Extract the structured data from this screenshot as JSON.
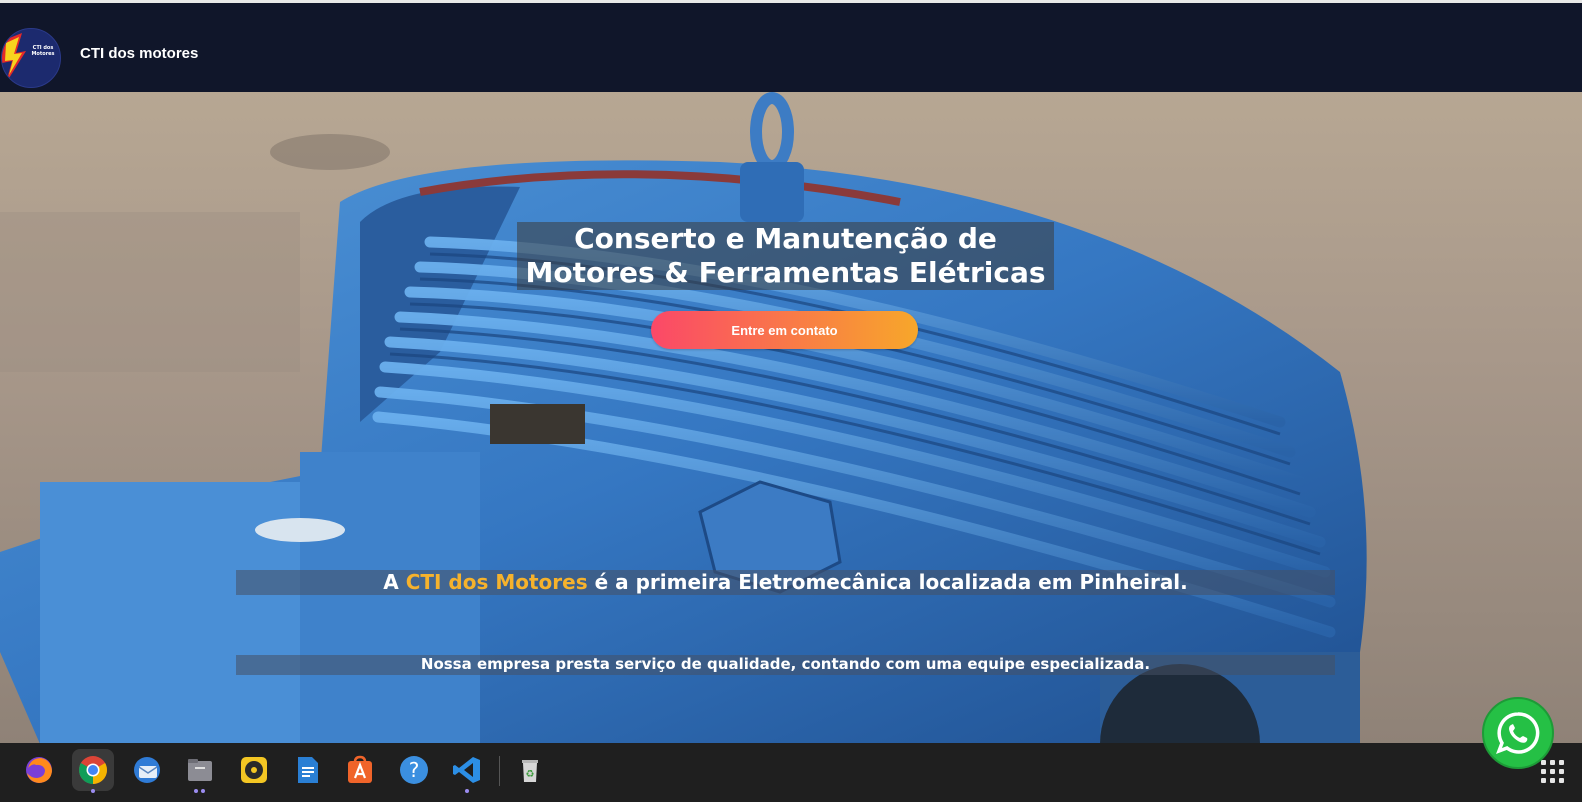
{
  "site": {
    "brand_name": "CTI dos motores",
    "logo_text": "CTI dos Motores"
  },
  "hero": {
    "title_line1": "Conserto e Manutenção de",
    "title_line2": "Motores & Ferramentas Elétricas",
    "cta_label": "Entre em contato",
    "info_prefix": "A ",
    "info_highlight": "CTI dos Motores",
    "info_suffix": " é a primeira Eletromecânica localizada em Pinheiral.",
    "info_secondary": "Nossa empresa presta serviço de qualidade, contando com uma equipe especializada."
  },
  "colors": {
    "navbar_bg": "#10162a",
    "highlight": "#f6b22c",
    "cta_gradient_start": "#fb4868",
    "cta_gradient_end": "#f7a72a",
    "whatsapp_green": "#25c045"
  },
  "taskbar": {
    "apps": [
      {
        "icon": "firefox-icon"
      },
      {
        "icon": "chrome-icon",
        "active": true
      },
      {
        "icon": "thunderbird-icon"
      },
      {
        "icon": "files-icon"
      },
      {
        "icon": "rhythmbox-icon"
      },
      {
        "icon": "writer-icon"
      },
      {
        "icon": "app-center-icon"
      },
      {
        "icon": "help-icon"
      },
      {
        "icon": "vscode-icon"
      },
      {
        "icon": "trash-icon"
      }
    ],
    "show_apps_icon": "apps-grid-icon"
  }
}
